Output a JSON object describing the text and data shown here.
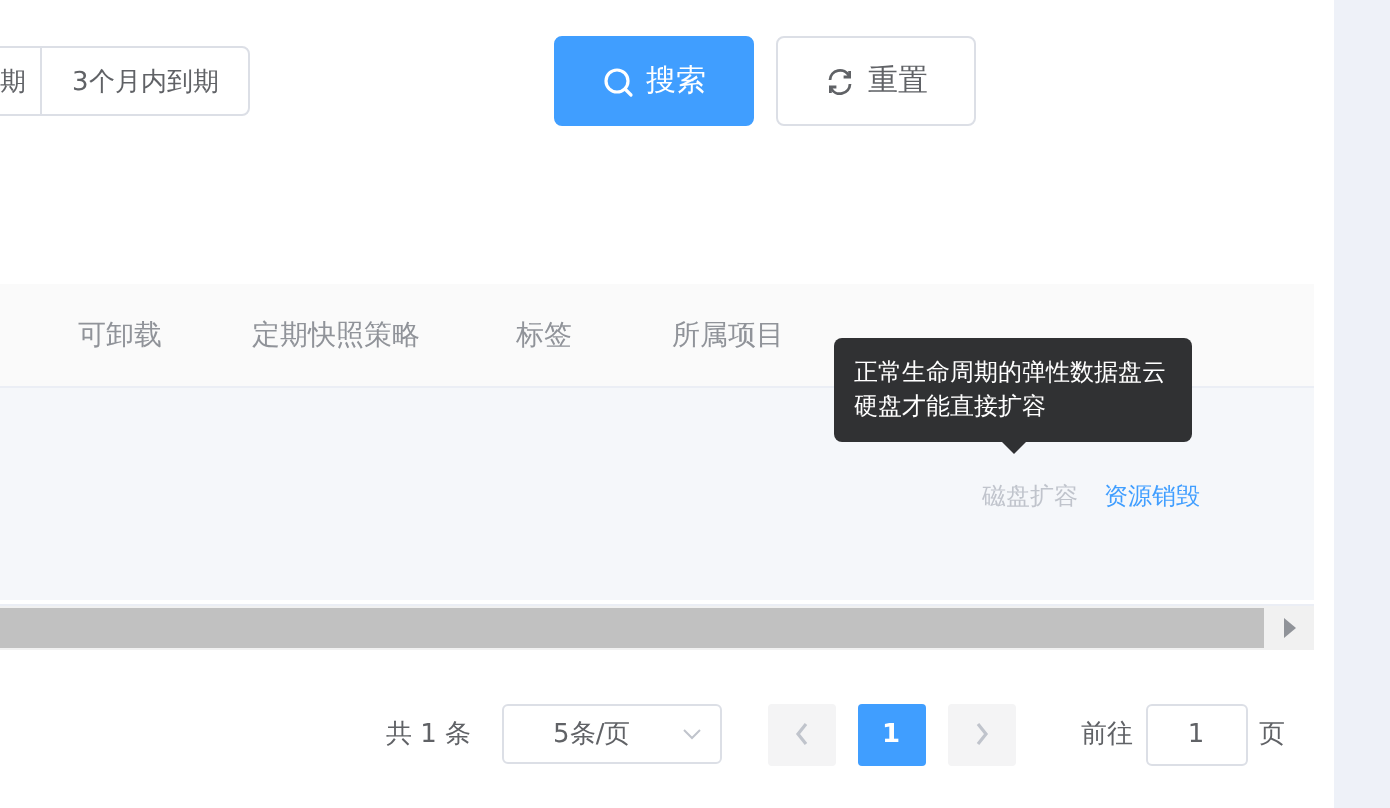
{
  "filter": {
    "date_options": [
      {
        "label": "期",
        "selected": false
      },
      {
        "label": "3个月内到期",
        "selected": false
      }
    ]
  },
  "buttons": [
    {
      "kind": "search",
      "label": "搜索"
    },
    {
      "kind": "reset",
      "label": "重置"
    }
  ],
  "table": {
    "columns": [
      "可卸载",
      "定期快照策略",
      "标签",
      "所属项目"
    ],
    "rows": [
      {
        "actions": [
          {
            "label": "磁盘扩容",
            "disabled": true
          },
          {
            "label": "资源销毁",
            "disabled": false
          }
        ]
      }
    ]
  },
  "tooltip": {
    "text": "正常生命周期的弹性数据盘云硬盘才能直接扩容"
  },
  "pagination": {
    "total": "共 1 条",
    "page_size": "5条/页",
    "prev_disabled": true,
    "next_disabled": true,
    "pages": [
      {
        "label": "1",
        "selected": true
      }
    ],
    "goto_label": "前往",
    "goto_value": "1",
    "goto_suffix": "页"
  }
}
